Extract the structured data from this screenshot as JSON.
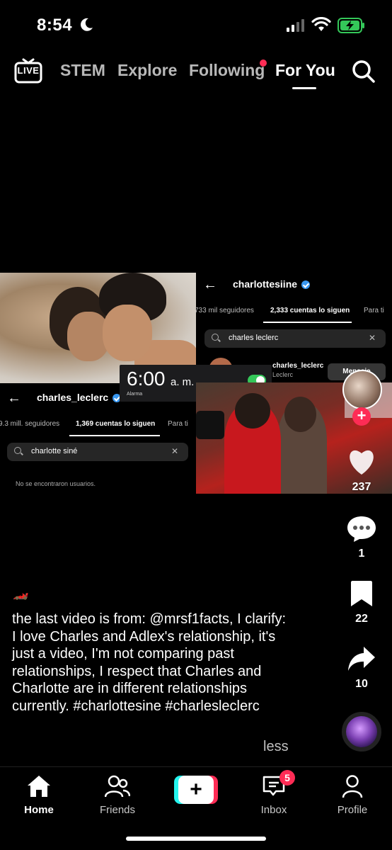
{
  "status_bar": {
    "time": "8:54",
    "icons": [
      "moon-icon",
      "cellular-signal-icon",
      "wifi-icon",
      "battery-charging-icon"
    ],
    "battery_color": "#34c759"
  },
  "top_nav": {
    "live_label": "LIVE",
    "tabs": [
      {
        "label": "STEM"
      },
      {
        "label": "Explore"
      },
      {
        "label": "Following"
      },
      {
        "label": "For You"
      }
    ],
    "active_tab": "For You",
    "accent": "#fe2c55"
  },
  "video": {
    "ig_right": {
      "username": "charlottesiine",
      "tabs": [
        "733 mil seguidores",
        "2,333 cuentas lo siguen",
        "Para ti"
      ],
      "search_value": "charles leclerc",
      "result_name": "charles_leclerc",
      "result_sub": "Leclerc",
      "result_button": "Mensaje"
    },
    "ig_left": {
      "username": "charles_leclerc",
      "tabs": [
        "9.3 mill. seguidores",
        "1,369 cuentas lo siguen",
        "Para ti"
      ],
      "search_value": "charlotte siné",
      "empty_text": "No se encontraron usuarios."
    },
    "alarm": {
      "time": "6:00",
      "ampm": "a. m.",
      "label": "Alarma"
    }
  },
  "actions": {
    "likes": "237",
    "comments": "1",
    "saves": "22",
    "shares": "10"
  },
  "caption": {
    "emoji": "🏎️",
    "text": "the last video is from: @mrsf1facts, I clarify: I love Charles and Adlex's relationship, it's just a video, I'm not comparing past relationships, I respect that Charles and Charlotte are in different relationships currently. #charlottesine #charlesleclerc",
    "less_label": "less"
  },
  "bottom_nav": {
    "items": [
      {
        "label": "Home"
      },
      {
        "label": "Friends"
      },
      {
        "label": "Inbox"
      },
      {
        "label": "Profile"
      }
    ],
    "inbox_badge": "5"
  }
}
